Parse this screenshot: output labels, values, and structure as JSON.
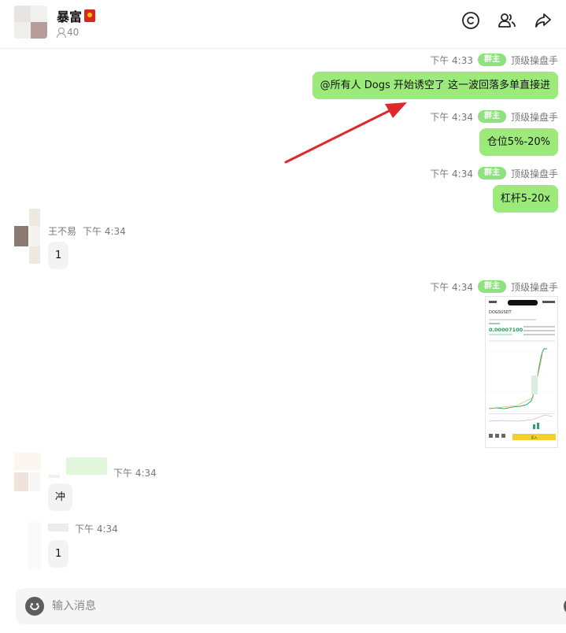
{
  "header": {
    "title": "暴富",
    "member_count": "40",
    "icons": [
      "circle-c-icon",
      "users-icon",
      "share-icon"
    ]
  },
  "messages": [
    {
      "time": "下午 4:33",
      "badge": "群主",
      "sender": "顶级操盘手",
      "text": "@所有人 Dogs 开始诱空了 这一波回落多单直接进"
    },
    {
      "time": "下午 4:34",
      "badge": "群主",
      "sender": "顶级操盘手",
      "text": "仓位5%-20%"
    },
    {
      "time": "下午 4:34",
      "badge": "群主",
      "sender": "顶级操盘手",
      "text": "杠杆5-20x"
    },
    {
      "sender": "王不易",
      "time": "下午 4:34",
      "text": "1"
    },
    {
      "time": "下午 4:34",
      "badge": "群主",
      "sender": "顶级操盘手"
    },
    {
      "time": "下午 4:34",
      "text": "冲"
    },
    {
      "time": "下午 4:34",
      "text": "1"
    }
  ],
  "screenshot": {
    "symbol": "DOGSUSDT",
    "price": "0.00007100",
    "action": "买入"
  },
  "input": {
    "placeholder": "输入消息"
  },
  "colors": {
    "bubble_out": "#9bea7a",
    "badge": "#8fe07e",
    "arrow": "#e0282a"
  }
}
